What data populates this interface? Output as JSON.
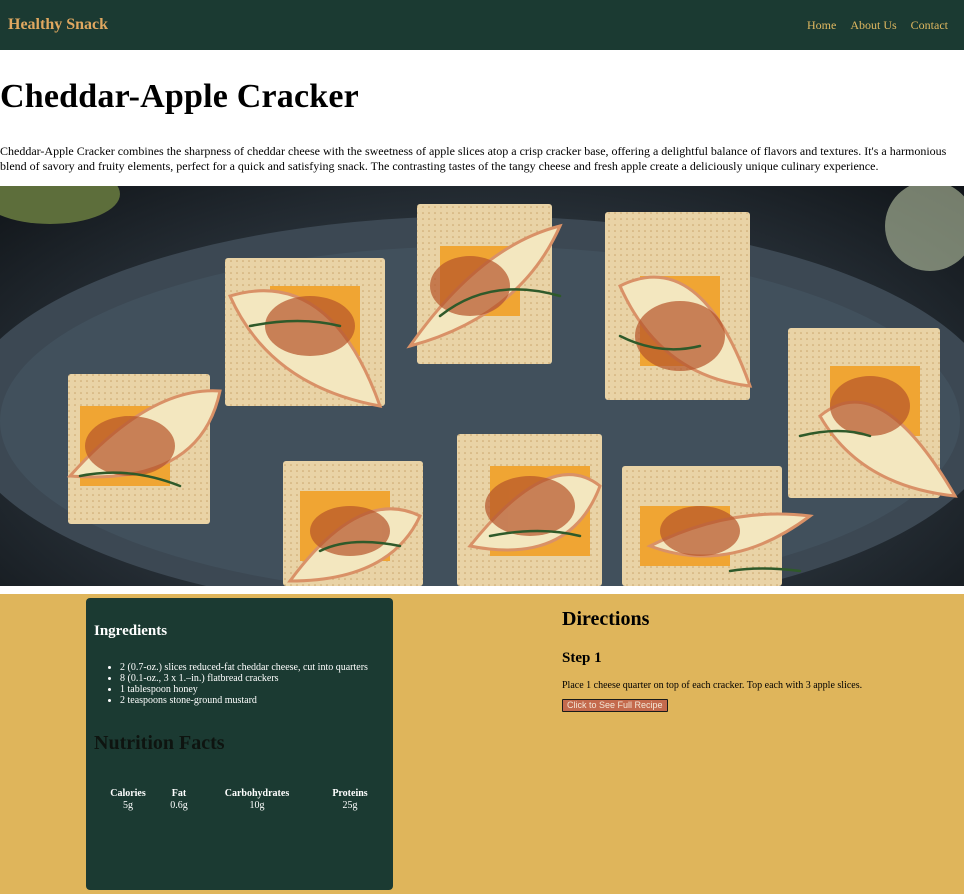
{
  "nav": {
    "brand": "Healthy Snack",
    "links": [
      "Home",
      "About Us",
      "Contact"
    ]
  },
  "recipe": {
    "title": "Cheddar-Apple Cracker",
    "description": "Cheddar-Apple Cracker combines the sharpness of cheddar cheese with the sweetness of apple slices atop a crisp cracker base, offering a delightful balance of flavors and textures. It's a harmonious blend of savory and fruity elements, perfect for a quick and satisfying snack. The contrasting tastes of the tangy cheese and fresh apple create a deliciously unique culinary experience."
  },
  "ingredients": {
    "heading": "Ingredients",
    "items": [
      "2 (0.7-oz.) slices reduced-fat cheddar cheese, cut into quarters",
      "8 (0.1-oz., 3 x 1.–in.) flatbread crackers",
      "1 tablespoon honey",
      "2 teaspoons stone-ground mustard"
    ]
  },
  "nutrition": {
    "heading": "Nutrition Facts",
    "facts": [
      {
        "label": "Calories",
        "value": "5g"
      },
      {
        "label": "Fat",
        "value": "0.6g"
      },
      {
        "label": "Carbohydrates",
        "value": "10g"
      },
      {
        "label": "Proteins",
        "value": "25g"
      }
    ]
  },
  "directions": {
    "heading": "Directions",
    "step_label": "Step 1",
    "step_text": "Place 1 cheese quarter on top of each cracker. Top each with 3 apple slices.",
    "button_label": "Click to See Full Recipe"
  },
  "colors": {
    "nav_bg": "#1b3a32",
    "brand": "#e0a860",
    "bottom_bg": "#dfb55b",
    "card_bg": "#1b3a32",
    "button_bg": "#c46a4d"
  }
}
